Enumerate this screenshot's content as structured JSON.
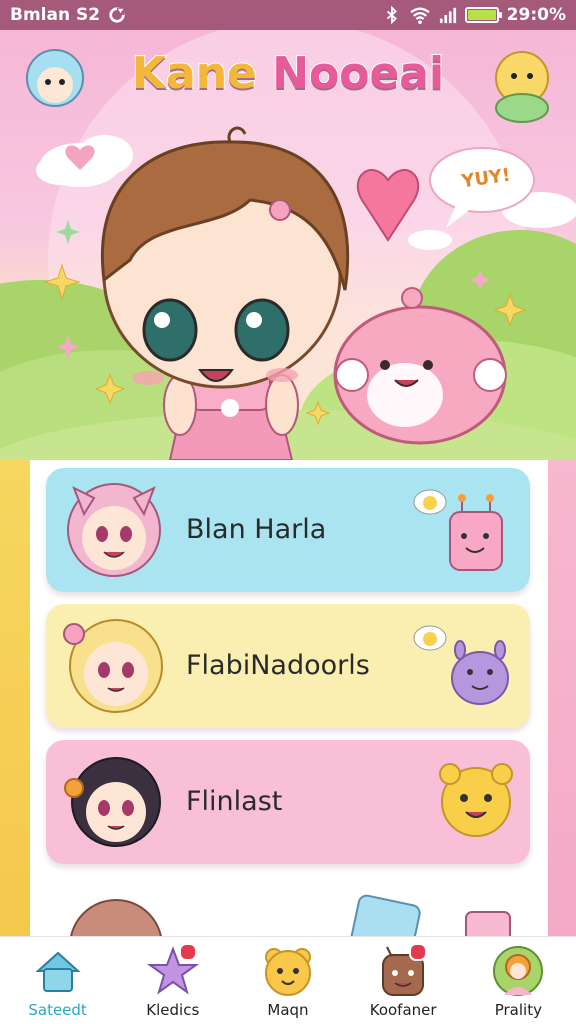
{
  "status_bar": {
    "left_text": "Bmlan S2",
    "right_text": "29:0%",
    "icons": [
      "sync-icon",
      "bluetooth-icon",
      "wifi-icon",
      "signal-icon",
      "battery-icon"
    ]
  },
  "header": {
    "title_part1": "Kane",
    "title_part2": "Nooeai",
    "speech_bubble_text": "YUY!"
  },
  "cards": [
    {
      "label": "Blan Harla",
      "color": "#a9e4f0"
    },
    {
      "label": "FlabiNadoorls",
      "color": "#fbeeb1"
    },
    {
      "label": "Flinlast",
      "color": "#f8bfd6"
    }
  ],
  "bottom_nav": {
    "items": [
      {
        "label": "Sateedt",
        "icon": "home-icon",
        "active": true
      },
      {
        "label": "Kledics",
        "icon": "star-icon",
        "badge": true
      },
      {
        "label": "Maqn",
        "icon": "bear-icon"
      },
      {
        "label": "Koofaner",
        "icon": "monster-icon",
        "badge": true
      },
      {
        "label": "Prality",
        "icon": "profile-icon"
      }
    ]
  },
  "colors": {
    "status_bar": "#a55a7a",
    "active_nav": "#2aa6c7",
    "hero_pink": "#f5b7d6",
    "battery_fill": "#b7e14a"
  }
}
